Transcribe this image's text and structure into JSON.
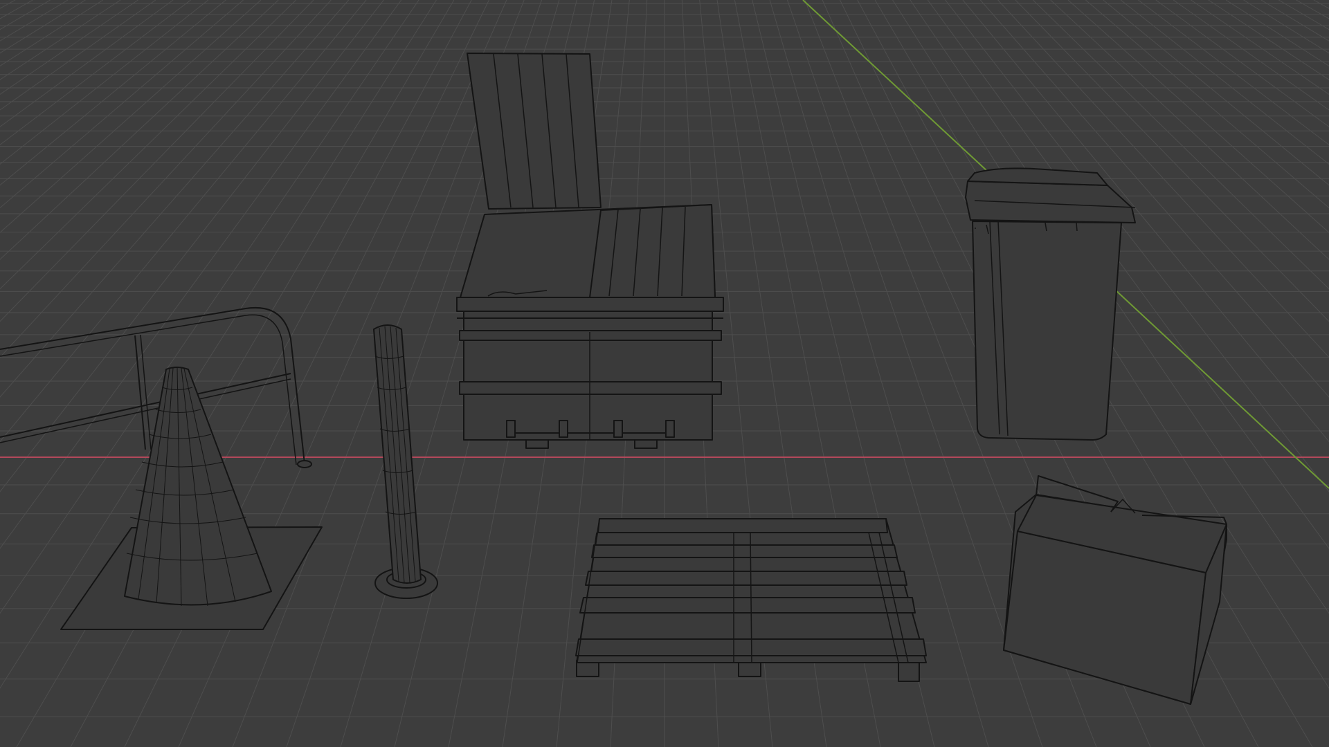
{
  "viewport": {
    "shading_mode": "wireframe",
    "background_color": "#3d3d3d",
    "grid_color": "#4e4e4e",
    "wire_color": "#141414",
    "x_axis_color": "#b3485a",
    "y_axis_color": "#6f9a34"
  },
  "scene_objects": [
    {
      "name": "railing",
      "kind": "metal guard rail"
    },
    {
      "name": "traffic-cone",
      "kind": "traffic cone on square base"
    },
    {
      "name": "bollard",
      "kind": "post bollard"
    },
    {
      "name": "dumpster",
      "kind": "dumpster with open lid"
    },
    {
      "name": "wheelie-bin",
      "kind": "wheeled trash bin"
    },
    {
      "name": "pallet",
      "kind": "wooden pallet"
    },
    {
      "name": "cardboard-box",
      "kind": "open cardboard box"
    }
  ]
}
